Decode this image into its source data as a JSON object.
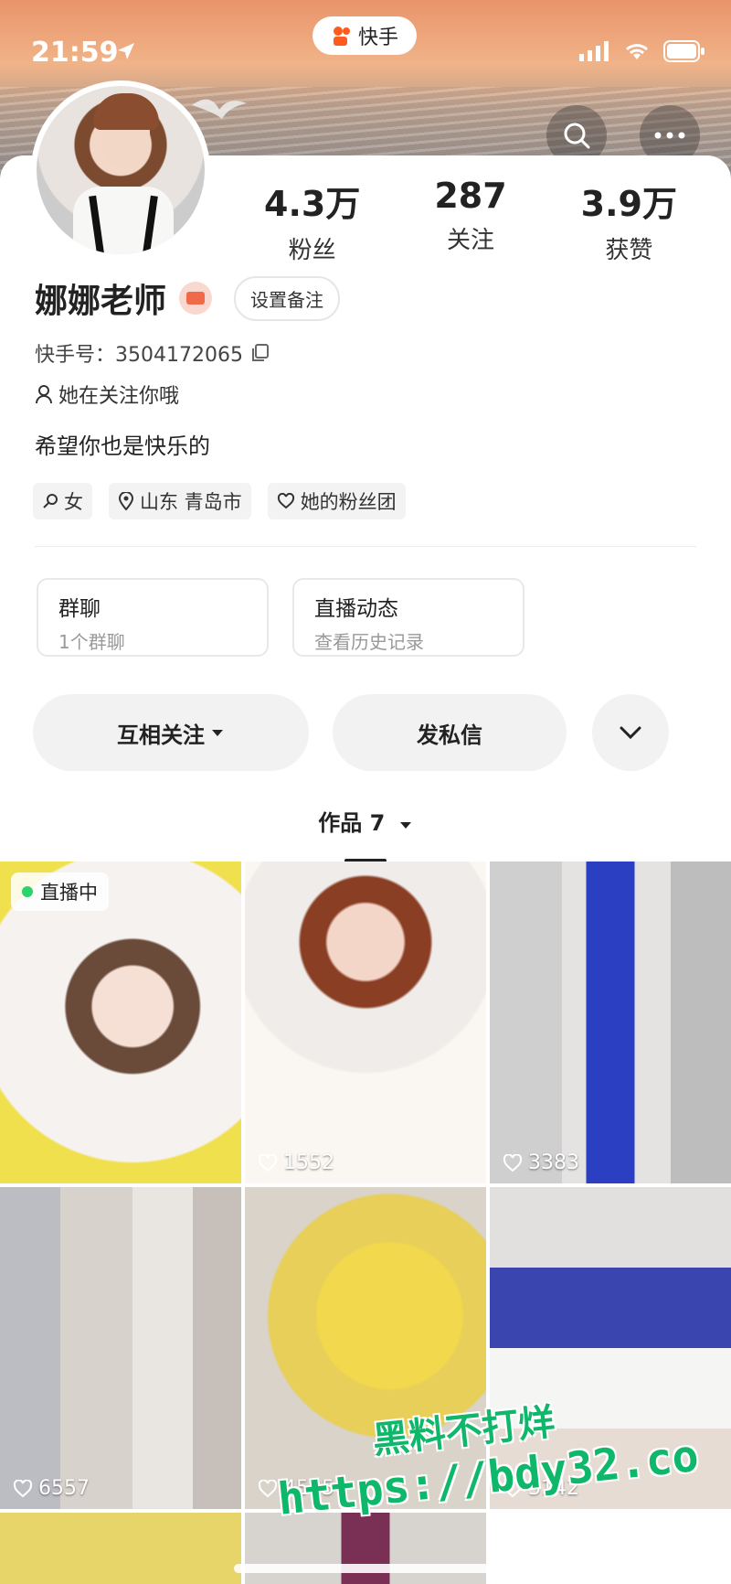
{
  "status_bar": {
    "time": "21:59",
    "app_name": "快手"
  },
  "profile": {
    "name": "娜娜老师",
    "remark_button": "设置备注",
    "uid_label": "快手号：3504172065",
    "follows_you": "她在关注你哦",
    "bio": "希望你也是快乐的",
    "tags": {
      "gender": "女",
      "location": "山东 青岛市",
      "fan_group": "她的粉丝团"
    }
  },
  "stats": [
    {
      "value": "4.3万",
      "label": "粉丝"
    },
    {
      "value": "287",
      "label": "关注"
    },
    {
      "value": "3.9万",
      "label": "获赞"
    }
  ],
  "info_cards": [
    {
      "title": "群聊",
      "subtitle": "1个群聊"
    },
    {
      "title": "直播动态",
      "subtitle": "查看历史记录"
    }
  ],
  "actions": {
    "follow": "互相关注",
    "message": "发私信"
  },
  "tab": {
    "label": "作品 7"
  },
  "posts": [
    {
      "live": "直播中",
      "likes": ""
    },
    {
      "live": "",
      "likes": "1552"
    },
    {
      "live": "",
      "likes": "3383"
    },
    {
      "live": "",
      "likes": "6557"
    },
    {
      "live": "",
      "likes": "4505"
    },
    {
      "live": "",
      "likes": "3142"
    }
  ],
  "watermark": {
    "line1": "黑料不打烊",
    "line2": "https://bdy32.co"
  },
  "colors": {
    "live_dot": "#2bd36f",
    "watermark": "#0fb76b",
    "badge": "#f06a4a"
  }
}
